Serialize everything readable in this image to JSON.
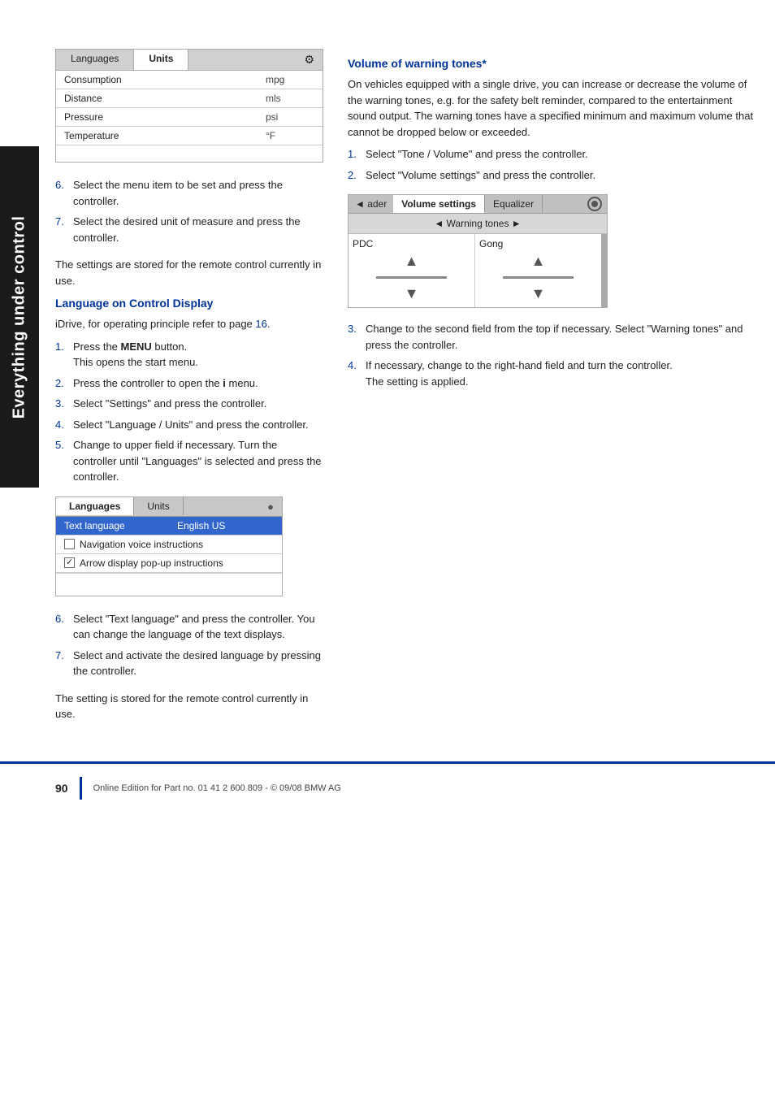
{
  "sidebar": {
    "label": "Everything under control"
  },
  "top_widget": {
    "tab_languages": "Languages",
    "tab_units": "Units",
    "icon": "⚙",
    "rows": [
      {
        "label": "Consumption",
        "value": "mpg",
        "highlighted": false
      },
      {
        "label": "Distance",
        "value": "mls",
        "highlighted": false
      },
      {
        "label": "Pressure",
        "value": "psi",
        "highlighted": false
      },
      {
        "label": "Temperature",
        "value": "°F",
        "highlighted": false
      }
    ]
  },
  "left_col": {
    "steps_1": [
      {
        "num": "6.",
        "text": "Select the menu item to be set and press the controller."
      },
      {
        "num": "7.",
        "text": "Select the desired unit of measure and press the controller."
      }
    ],
    "para_stored": "The settings are stored for the remote control currently in use.",
    "section_heading": "Language on Control Display",
    "para_idrive": "iDrive, for operating principle refer to page 16.",
    "steps_2": [
      {
        "num": "1.",
        "text": "Press the MENU button. This opens the start menu.",
        "bold_word": "MENU"
      },
      {
        "num": "2.",
        "text": "Press the controller to open the i menu."
      },
      {
        "num": "3.",
        "text": "Select \"Settings\" and press the controller."
      },
      {
        "num": "4.",
        "text": "Select \"Language / Units\" and press the controller."
      },
      {
        "num": "5.",
        "text": "Change to upper field if necessary. Turn the controller until \"Languages\" is selected and press the controller."
      }
    ],
    "lang_widget": {
      "tab_languages": "Languages",
      "tab_units": "Units",
      "icon": "●",
      "rows": [
        {
          "label": "Text language",
          "value": "English US",
          "highlighted": true
        },
        {
          "label": "Navigation voice instructions",
          "checkbox": "empty"
        },
        {
          "label": "Arrow display pop-up instructions",
          "checkbox": "checked"
        }
      ]
    },
    "steps_3": [
      {
        "num": "6.",
        "text": "Select \"Text language\" and press the controller. You can change the language of the text displays."
      },
      {
        "num": "7.",
        "text": "Select and activate the desired language by pressing the controller."
      }
    ],
    "para_stored2": "The setting is stored for the remote control currently in use."
  },
  "right_col": {
    "section_heading": "Volume of warning tones*",
    "para1": "On vehicles equipped with a single drive, you can increase or decrease the volume of the warning tones, e.g. for the safety belt reminder, compared to the entertainment sound output. The warning tones have a specified minimum and maximum volume that cannot be dropped below or exceeded.",
    "steps": [
      {
        "num": "1.",
        "text": "Select \"Tone / Volume\" and press the controller."
      },
      {
        "num": "2.",
        "text": "Select \"Volume settings\" and press the controller."
      }
    ],
    "vol_widget": {
      "back_label": "◄ ader",
      "tab_volume": "Volume settings",
      "tab_equalizer": "Equalizer",
      "tab_icon": "⚙",
      "sub_header": "◄ Warning tones ►",
      "col_left_label": "PDC",
      "col_right_label": "Gong"
    },
    "steps_2": [
      {
        "num": "3.",
        "text": "Change to the second field from the top if necessary. Select \"Warning tones\" and press the controller."
      },
      {
        "num": "4.",
        "text": "If necessary, change to the right-hand field and turn the controller. The setting is applied."
      }
    ]
  },
  "footer": {
    "page_number": "90",
    "text": "Online Edition for Part no. 01 41 2 600 809 - © 09/08 BMW AG"
  }
}
